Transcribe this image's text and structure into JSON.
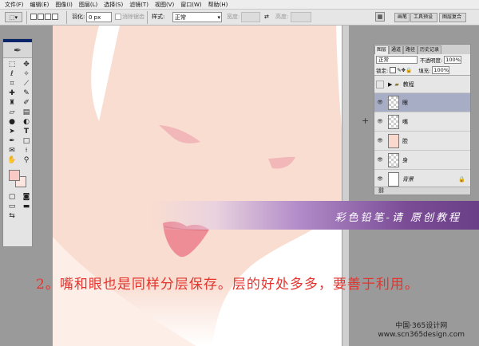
{
  "menu": [
    "文件(F)",
    "编辑(E)",
    "图像(I)",
    "图层(L)",
    "选择(S)",
    "滤镜(T)",
    "视图(V)",
    "窗口(W)",
    "帮助(H)"
  ],
  "options": {
    "feather_label": "羽化:",
    "feather_value": "0 px",
    "antialias_label": "消除锯齿",
    "style_label": "样式:",
    "style_value": "正常",
    "width_label": "宽度:",
    "height_label": "高度:"
  },
  "panel_well": {
    "tab1": "画笔",
    "tab2": "工具预设",
    "tab3": "图层复合"
  },
  "layers_panel": {
    "tabs": [
      "图层",
      "通道",
      "路径",
      "历史记录"
    ],
    "blend_mode": "正常",
    "opacity_label": "不透明度:",
    "opacity_value": "100%",
    "lock_label": "锁定:",
    "fill_label": "填充:",
    "fill_value": "100%",
    "layers": [
      {
        "name": "教程",
        "kind": "group"
      },
      {
        "name": "眼",
        "kind": "layer"
      },
      {
        "name": "嘴",
        "kind": "layer"
      },
      {
        "name": "脸",
        "kind": "layer"
      },
      {
        "name": "身",
        "kind": "layer"
      },
      {
        "name": "背景",
        "kind": "background"
      }
    ],
    "selected_layer": "眼"
  },
  "colors": {
    "foreground": "#f8c9c5",
    "background": "#fde6df",
    "caption": "#e3342e",
    "banner": "#7a4c96"
  },
  "banner_text": "彩色铅笔-请 原创教程",
  "caption": "2。嘴和眼也是同样分层保存。层的好处多多，要善于利用。",
  "watermark": {
    "line1": "中国·365设计网",
    "line2": "www.scn365design.com"
  },
  "icons": [
    "marquee-icon",
    "move-icon",
    "lasso-icon",
    "magic-wand-icon",
    "crop-icon",
    "slice-icon",
    "healing-brush-icon",
    "brush-icon",
    "clone-stamp-icon",
    "history-brush-icon",
    "eraser-icon",
    "gradient-icon",
    "blur-icon",
    "dodge-icon",
    "path-select-icon",
    "type-icon",
    "pen-icon",
    "shape-icon",
    "notes-icon",
    "eyedropper-icon",
    "hand-icon",
    "zoom-icon",
    "eye-icon",
    "folder-icon",
    "lock-icon",
    "chain-icon"
  ]
}
